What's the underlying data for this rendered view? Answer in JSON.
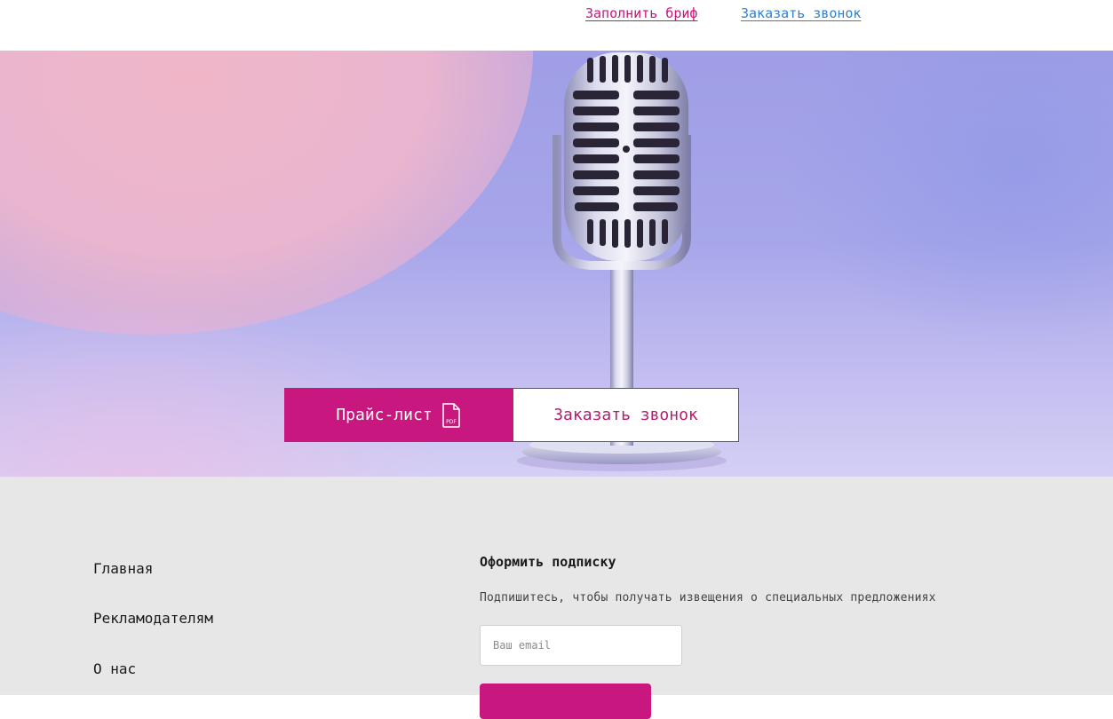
{
  "header": {
    "brief_link": "Заполнить бриф",
    "call_link": "Заказать звонок"
  },
  "hero": {
    "price_button": "Прайс-лист",
    "price_button_icon": "pdf-file-icon",
    "pdf_badge": "PDF",
    "call_button": "Заказать звонок"
  },
  "footer": {
    "nav": [
      {
        "label": "Главная"
      },
      {
        "label": "Рекламодателям"
      },
      {
        "label": "О нас"
      }
    ],
    "subscribe": {
      "title": "Оформить подписку",
      "text": "Подпишитесь, чтобы получать извещения о специальных предложениях",
      "email_placeholder": "Ваш email"
    }
  },
  "colors": {
    "accent": "#c8177e",
    "link_blue": "#2f7fd0",
    "footer_bg": "#e7e7e7"
  }
}
